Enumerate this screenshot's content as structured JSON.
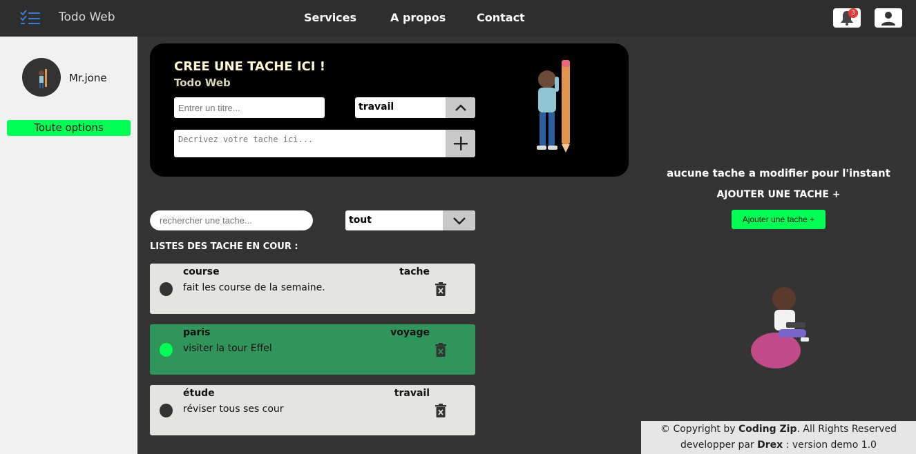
{
  "header": {
    "app_title": "Todo Web",
    "nav": [
      "Services",
      "A propos",
      "Contact"
    ],
    "notification_count": "3"
  },
  "sidebar": {
    "username": "Mr.jone",
    "options_label": "Toute options"
  },
  "create": {
    "title": "CREE UNE TACHE ICI !",
    "subtitle": "Todo Web",
    "title_placeholder": "Entrer un titre...",
    "category_value": "travail",
    "description_placeholder": "Decrivez votre tache ici..."
  },
  "filters": {
    "search_placeholder": "rechercher une tache...",
    "filter_value": "tout"
  },
  "list": {
    "heading": "LISTES DES TACHE EN COUR :",
    "tasks": [
      {
        "title": "course",
        "category": "tache",
        "description": "fait les course de la semaine.",
        "done": false
      },
      {
        "title": "paris",
        "category": "voyage",
        "description": "visiter la tour Effel",
        "done": true
      },
      {
        "title": "étude",
        "category": "travail",
        "description": "réviser tous ses cour",
        "done": false
      }
    ]
  },
  "right_panel": {
    "empty_message": "aucune tache a modifier pour l'instant",
    "add_heading": "AJOUTER UNE TACHE +",
    "add_button": "Ajouter une tache +"
  },
  "footer": {
    "copyright_prefix": "© Copyright by",
    "brand": "Coding Zip",
    "copyright_suffix": ". All Rights Reserved",
    "dev_prefix": "developper par",
    "dev_name": "Drex",
    "dev_suffix": ": version demo 1.0"
  },
  "colors": {
    "accent_green": "#00ff55",
    "done_task_bg": "#2f955a",
    "topbar_bg": "#2e2e2e"
  }
}
